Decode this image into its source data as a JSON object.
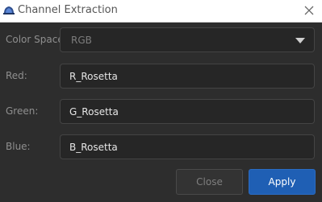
{
  "window": {
    "title": "Channel Extraction",
    "icon": "app-logo-icon"
  },
  "form": {
    "color_space": {
      "label": "Color Space:",
      "value": "RGB"
    },
    "red": {
      "label": "Red:",
      "value": "R_Rosetta"
    },
    "green": {
      "label": "Green:",
      "value": "G_Rosetta"
    },
    "blue": {
      "label": "Blue:",
      "value": "B_Rosetta"
    }
  },
  "buttons": {
    "close_label": "Close",
    "apply_label": "Apply"
  },
  "colors": {
    "background": "#2d2d2d",
    "field_background": "#262626",
    "accent": "#1f5fb4"
  }
}
